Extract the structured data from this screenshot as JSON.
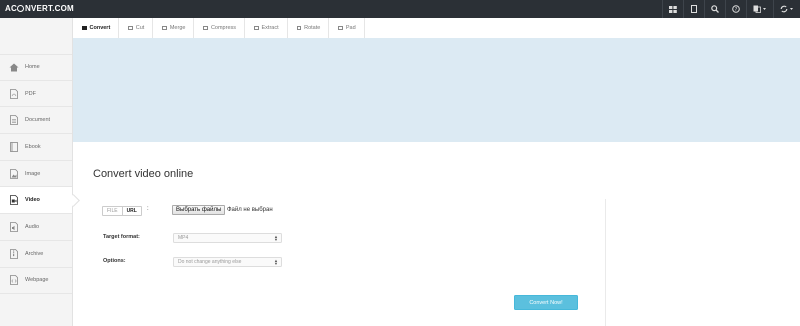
{
  "app": {
    "logo_left": "AC",
    "logo_right": "NVERT.COM"
  },
  "topbar": {
    "icons": [
      "grid-icon",
      "bookmark-icon",
      "search-icon",
      "help-icon",
      "language-icon",
      "refresh-icon"
    ]
  },
  "tabs": [
    {
      "label": "Convert",
      "active": true
    },
    {
      "label": "Cut",
      "active": false
    },
    {
      "label": "Merge",
      "active": false
    },
    {
      "label": "Compress",
      "active": false
    },
    {
      "label": "Extract",
      "active": false
    },
    {
      "label": "Rotate",
      "active": false
    },
    {
      "label": "Pad",
      "active": false
    }
  ],
  "sidebar": {
    "items": [
      {
        "label": "Home",
        "icon": "home-icon"
      },
      {
        "label": "PDF",
        "icon": "pdf-file-icon"
      },
      {
        "label": "Document",
        "icon": "document-file-icon"
      },
      {
        "label": "Ebook",
        "icon": "ebook-icon"
      },
      {
        "label": "Image",
        "icon": "image-file-icon"
      },
      {
        "label": "Video",
        "icon": "video-file-icon",
        "active": true
      },
      {
        "label": "Audio",
        "icon": "audio-file-icon"
      },
      {
        "label": "Archive",
        "icon": "archive-file-icon"
      },
      {
        "label": "Webpage",
        "icon": "webpage-file-icon"
      }
    ]
  },
  "main": {
    "title": "Convert video online",
    "source_toggle": {
      "file": "FILE",
      "url": "URL",
      "selected": "URL"
    },
    "colon": ":",
    "file_button": "Выбрать файлы",
    "file_status": "Файл не выбран",
    "target_format_label": "Target format:",
    "target_format_value": "MP4",
    "options_label": "Options:",
    "options_value": "Do not change anything else",
    "convert_button": "Convert Now!"
  },
  "colors": {
    "topbar": "#2b3036",
    "banner": "#dceaf3",
    "sidebar": "#f4f4f4",
    "accent": "#5bc0de"
  }
}
